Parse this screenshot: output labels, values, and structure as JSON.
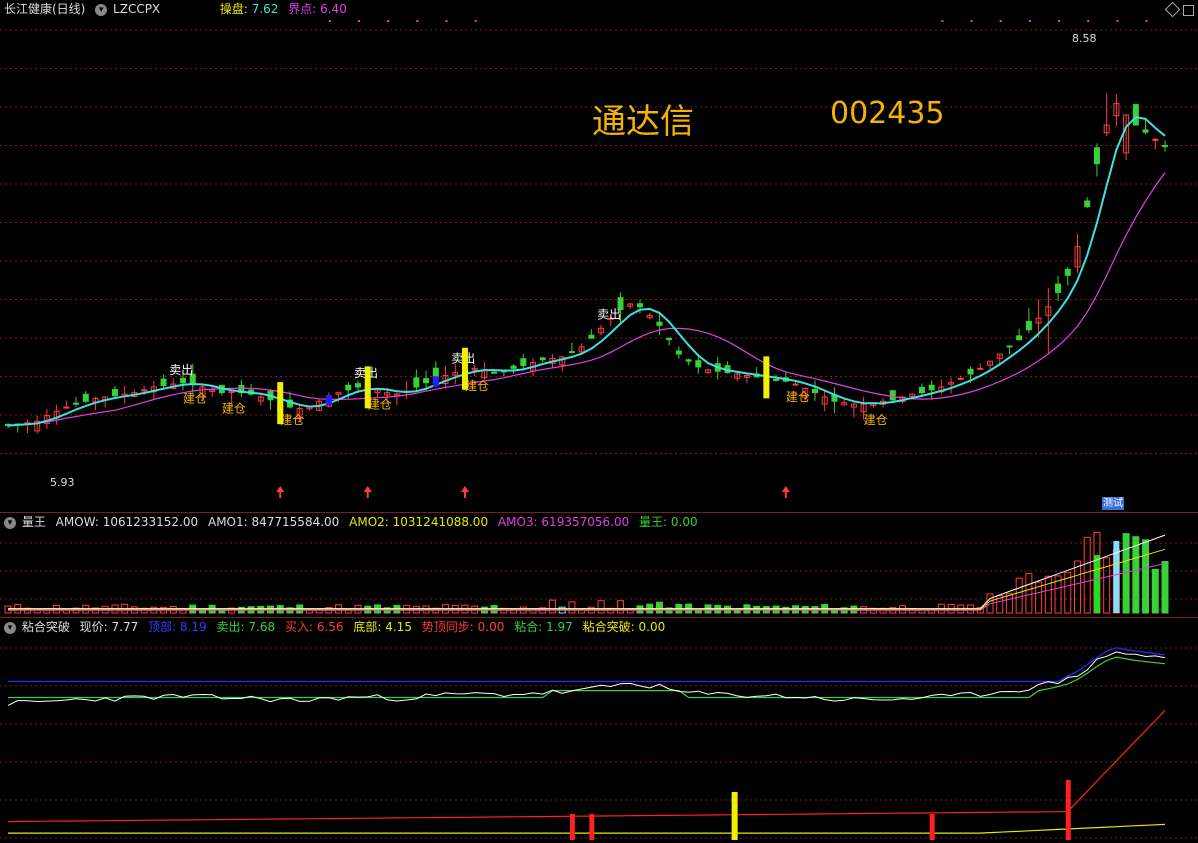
{
  "main": {
    "title": "长江健康(日线)",
    "indicator": "LZCCPX",
    "caopan_label": "操盘:",
    "caopan_value": "7.62",
    "jiedian_label": "界点:",
    "jiedian_value": "6.40",
    "watermark_app": "通达信",
    "watermark_code": "002435",
    "high_label": "8.58",
    "low_label": "5.93",
    "signals": {
      "sell": "卖出",
      "build": "建仓"
    },
    "badge": "测试"
  },
  "volume": {
    "name": "量王",
    "amow_label": "AMOW:",
    "amow_value": "1061233152.00",
    "amo1_label": "AMO1:",
    "amo1_value": "847715584.00",
    "amo2_label": "AMO2:",
    "amo2_value": "1031241088.00",
    "amo3_label": "AMO3:",
    "amo3_value": "619357056.00",
    "lw_label": "量王:",
    "lw_value": "0.00"
  },
  "indicator": {
    "name": "粘合突破",
    "price_label": "现价:",
    "price_value": "7.77",
    "top_label": "顶部:",
    "top_value": "8.19",
    "sell_label": "卖出:",
    "sell_value": "7.68",
    "buy_label": "买入:",
    "buy_value": "6.56",
    "bottom_label": "底部:",
    "bottom_value": "4.15",
    "sync_label": "势顶同步:",
    "sync_value": "0.00",
    "stick_label": "粘合:",
    "stick_value": "1.97",
    "breakout_label": "粘合突破:",
    "breakout_value": "0.00"
  },
  "colors": {
    "up": "#ff3c3c",
    "down": "#39d039",
    "ma1": "#40e0e0",
    "ma2": "#e040e0",
    "grid": "#7a1f1f",
    "gold": "#f5b400"
  },
  "chart_data": [
    {
      "type": "candlestick",
      "title": "长江健康(日线)",
      "ylim": [
        5.5,
        8.7
      ],
      "close_series": [
        5.95,
        5.96,
        5.97,
        5.98,
        6.02,
        6.05,
        6.08,
        6.1,
        6.12,
        6.14,
        6.15,
        6.16,
        6.17,
        6.18,
        6.2,
        6.22,
        6.23,
        6.24,
        6.25,
        6.24,
        6.22,
        6.2,
        6.18,
        6.19,
        6.18,
        6.17,
        6.15,
        6.13,
        6.1,
        6.08,
        6.07,
        6.08,
        6.12,
        6.15,
        6.18,
        6.2,
        6.22,
        6.21,
        6.2,
        6.18,
        6.17,
        6.19,
        6.22,
        6.25,
        6.28,
        6.3,
        6.32,
        6.34,
        6.35,
        6.34,
        6.32,
        6.33,
        6.35,
        6.37,
        6.39,
        6.41,
        6.42,
        6.43,
        6.46,
        6.5,
        6.56,
        6.63,
        6.7,
        6.76,
        6.8,
        6.78,
        6.72,
        6.65,
        6.55,
        6.45,
        6.4,
        6.36,
        6.34,
        6.33,
        6.32,
        6.31,
        6.3,
        6.29,
        6.28,
        6.27,
        6.26,
        6.24,
        6.21,
        6.18,
        6.15,
        6.12,
        6.11,
        6.1,
        6.1,
        6.11,
        6.12,
        6.13,
        6.15,
        6.17,
        6.18,
        6.2,
        6.22,
        6.25,
        6.28,
        6.31,
        6.35,
        6.4,
        6.45,
        6.5,
        6.55,
        6.62,
        6.7,
        6.78,
        6.88,
        7.0,
        7.2,
        7.48,
        7.78,
        8.05,
        8.2,
        8.12,
        8.05,
        8.0,
        7.95,
        7.9
      ],
      "ma_fast_label": "MA (cyan)",
      "ma_slow_label": "MA (magenta)"
    },
    {
      "type": "bar",
      "title": "量王",
      "note": "volume bars"
    },
    {
      "type": "line",
      "title": "粘合突破",
      "series_names": [
        "顶部",
        "卖出",
        "买入",
        "现价",
        "底部"
      ]
    }
  ]
}
